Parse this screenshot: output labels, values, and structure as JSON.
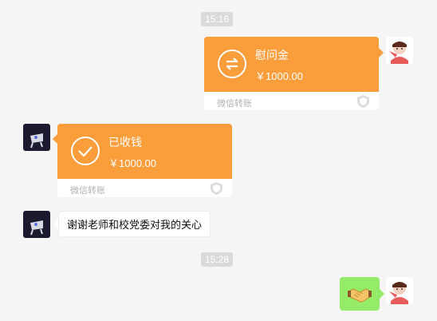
{
  "timestamps": [
    "15:16",
    "15:28"
  ],
  "messages": {
    "m1": {
      "title": "慰问金",
      "amount": "￥1000.00",
      "footer": "微信转账"
    },
    "m2": {
      "title": "已收钱",
      "amount": "￥1000.00",
      "footer": "微信转账"
    },
    "m3": {
      "text": "谢谢老师和校党委对我的关心"
    },
    "m4": {
      "emoji": "handshake"
    }
  },
  "colors": {
    "transfer_orange": "#fa9d3b",
    "sent_green": "#95ec69",
    "background": "#f5f5f5",
    "time_badge": "#dadada"
  }
}
